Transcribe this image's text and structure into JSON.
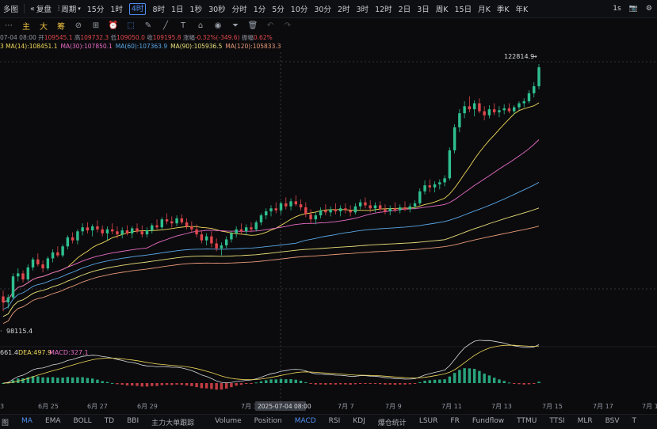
{
  "toolbar": {
    "multi_chart_label": "多图",
    "replay_label": "复盘",
    "period_label": "周期",
    "intervals": [
      "15分",
      "1时",
      "4时",
      "8时",
      "1日",
      "1秒",
      "30秒",
      "分时",
      "1分",
      "5分",
      "10分",
      "30分",
      "2时",
      "3时",
      "12时",
      "2日",
      "3日",
      "周K",
      "15日",
      "月K",
      "季K",
      "年K"
    ],
    "active_interval": "4时",
    "realtime_label": "1s"
  },
  "drawbar": {
    "indicator_labels": [
      "主",
      "大",
      "筹"
    ]
  },
  "ohlc": {
    "date": "07-04 08:00",
    "open_label": "开",
    "open": "109545.1",
    "high_label": "高",
    "high": "109732.3",
    "low_label": "低",
    "low": "109050.0",
    "close_label": "收",
    "close": "109195.8",
    "change_label": "涨幅",
    "change": "-0.32%(-349.6)",
    "amp_label": "振幅",
    "amp": "0.62%"
  },
  "ma": [
    {
      "text": "MA(14):108451.1",
      "color": "#f0d85a"
    },
    {
      "text": "MA(30):107850.1",
      "color": "#e86cc7"
    },
    {
      "text": "MA(60):107363.9",
      "color": "#5aa7e6"
    },
    {
      "text": "MA(90):105936.5",
      "color": "#e9e07a"
    },
    {
      "text": "MA(120):105833.3",
      "color": "#e89a7a"
    }
  ],
  "ma_prefix": "3",
  "price_labels": {
    "high_marker": "122814.9",
    "low_marker": "98115.4"
  },
  "macd_info": {
    "dif": "661.4",
    "dea": "DEA:497.9",
    "macd": "MACD:327.1"
  },
  "x_labels": [
    "3",
    "6月 25",
    "6月 27",
    "6月 29",
    "7月 3",
    "7月 7",
    "7月 9",
    "7月 11",
    "7月 13",
    "7月 15",
    "7月 17",
    "7月 1"
  ],
  "crosshair_date": "2025-07-04 08:00",
  "bottom_tabs": [
    "MA",
    "EMA",
    "BOLL",
    "TD",
    "BBI",
    "主力大单跟踪",
    "Volume",
    "Position",
    "MACD",
    "RSI",
    "KDJ",
    "爆仓统计",
    "LSUR",
    "FR",
    "Fundflow",
    "TTMU",
    "TTSI",
    "MLR",
    "BSV",
    "T"
  ],
  "bottom_left_label": "图",
  "active_main_tab": "MA",
  "active_sub_tab": "MACD",
  "colors": {
    "up": "#2fbf8f",
    "down": "#e0474c",
    "accent": "#4f8df0"
  },
  "chart_data": {
    "type": "candlestick",
    "interval": "4时",
    "candles": [
      [
        99600,
        100200,
        98115,
        99000
      ],
      [
        99000,
        99800,
        98400,
        99500
      ],
      [
        99500,
        101900,
        99300,
        101600
      ],
      [
        101600,
        102400,
        101100,
        101900
      ],
      [
        101900,
        102200,
        101000,
        101300
      ],
      [
        101300,
        102800,
        101100,
        102500
      ],
      [
        102500,
        103500,
        102200,
        103300
      ],
      [
        103300,
        103900,
        102600,
        102800
      ],
      [
        102800,
        103200,
        102000,
        102400
      ],
      [
        102400,
        103600,
        102200,
        103400
      ],
      [
        103400,
        104300,
        103000,
        104000
      ],
      [
        104000,
        104600,
        103500,
        103700
      ],
      [
        103700,
        104800,
        103500,
        104600
      ],
      [
        104600,
        105700,
        104300,
        105500
      ],
      [
        105500,
        106000,
        104900,
        105200
      ],
      [
        105200,
        106300,
        104800,
        106100
      ],
      [
        106100,
        106900,
        105700,
        106500
      ],
      [
        106500,
        107000,
        105900,
        106200
      ],
      [
        106200,
        106800,
        105600,
        106600
      ],
      [
        106600,
        107200,
        106000,
        106300
      ],
      [
        106300,
        106700,
        105600,
        105900
      ],
      [
        105900,
        106600,
        105200,
        106300
      ],
      [
        106300,
        106900,
        105800,
        106100
      ],
      [
        106100,
        106600,
        105400,
        105800
      ],
      [
        105800,
        106500,
        105400,
        106200
      ],
      [
        106200,
        106700,
        105700,
        105900
      ],
      [
        105900,
        106600,
        105400,
        106400
      ],
      [
        106400,
        106900,
        105900,
        106100
      ],
      [
        106100,
        106700,
        105500,
        105800
      ],
      [
        105800,
        106500,
        105500,
        106200
      ],
      [
        106200,
        106900,
        105900,
        106700
      ],
      [
        106700,
        107300,
        106300,
        106500
      ],
      [
        106500,
        107500,
        106200,
        107300
      ],
      [
        107300,
        107900,
        106800,
        107100
      ],
      [
        107100,
        107600,
        106500,
        106900
      ],
      [
        106900,
        107700,
        106600,
        107400
      ],
      [
        107400,
        107800,
        106800,
        107000
      ],
      [
        107000,
        107400,
        106300,
        106600
      ],
      [
        106600,
        107100,
        106000,
        106300
      ],
      [
        106300,
        106800,
        105500,
        105800
      ],
      [
        105800,
        106200,
        104900,
        105200
      ],
      [
        105200,
        105900,
        104700,
        105600
      ],
      [
        105600,
        106100,
        104500,
        104900
      ],
      [
        104900,
        105400,
        104100,
        104400
      ],
      [
        104400,
        105000,
        103700,
        104700
      ],
      [
        104700,
        105600,
        104400,
        105300
      ],
      [
        105300,
        106100,
        105000,
        105900
      ],
      [
        105900,
        106600,
        105500,
        106300
      ],
      [
        106300,
        106900,
        105800,
        106100
      ],
      [
        106100,
        106800,
        105700,
        106500
      ],
      [
        106500,
        107000,
        106000,
        106300
      ],
      [
        106300,
        107200,
        106100,
        107000
      ],
      [
        107000,
        107900,
        106700,
        107700
      ],
      [
        107700,
        108400,
        107300,
        108100
      ],
      [
        108100,
        108700,
        107600,
        108400
      ],
      [
        108400,
        109000,
        107900,
        108200
      ],
      [
        108200,
        109100,
        107800,
        108900
      ],
      [
        108900,
        109500,
        108300,
        108600
      ],
      [
        108600,
        109400,
        108200,
        109100
      ],
      [
        109100,
        109700,
        108600,
        108800
      ],
      [
        108800,
        109300,
        108200,
        108500
      ],
      [
        108500,
        109000,
        107500,
        107800
      ],
      [
        107800,
        108300,
        106900,
        107300
      ],
      [
        107300,
        108000,
        106800,
        107700
      ],
      [
        107700,
        108500,
        107400,
        108200
      ],
      [
        108200,
        108800,
        107700,
        108000
      ],
      [
        108000,
        108600,
        107600,
        108300
      ],
      [
        108300,
        108900,
        107800,
        108100
      ],
      [
        108100,
        108700,
        107600,
        108400
      ],
      [
        108400,
        108900,
        107900,
        108200
      ],
      [
        108200,
        108700,
        107600,
        108000
      ],
      [
        108000,
        108900,
        107800,
        108600
      ],
      [
        108600,
        109300,
        108300,
        109000
      ],
      [
        109000,
        109500,
        108400,
        108700
      ],
      [
        108700,
        109200,
        108000,
        108400
      ],
      [
        108400,
        109000,
        108000,
        108700
      ],
      [
        108700,
        109100,
        108100,
        108300
      ],
      [
        108300,
        108800,
        107800,
        108100
      ],
      [
        108100,
        108700,
        107700,
        108400
      ],
      [
        108400,
        109000,
        108000,
        108200
      ],
      [
        108200,
        108800,
        107900,
        108500
      ],
      [
        108500,
        109100,
        108100,
        108300
      ],
      [
        108300,
        108900,
        108000,
        108600
      ],
      [
        108600,
        109200,
        108300,
        108900
      ],
      [
        108900,
        110400,
        108700,
        110100
      ],
      [
        110100,
        111200,
        109800,
        110700
      ],
      [
        110700,
        111300,
        110000,
        110500
      ],
      [
        110500,
        111100,
        110000,
        110800
      ],
      [
        110800,
        111300,
        110300,
        111000
      ],
      [
        111000,
        111700,
        110600,
        111400
      ],
      [
        111400,
        114500,
        111200,
        114200
      ],
      [
        114200,
        116800,
        113900,
        116500
      ],
      [
        116500,
        118300,
        116000,
        117900
      ],
      [
        117900,
        119100,
        117400,
        118600
      ],
      [
        118600,
        119600,
        118000,
        118300
      ],
      [
        118300,
        119200,
        117600,
        118900
      ],
      [
        118900,
        119400,
        117900,
        118100
      ],
      [
        118100,
        118600,
        117200,
        117700
      ],
      [
        117700,
        118700,
        117400,
        118300
      ],
      [
        118300,
        118900,
        117700,
        118000
      ],
      [
        118000,
        118600,
        117500,
        118200
      ],
      [
        118200,
        118800,
        117800,
        118400
      ],
      [
        118400,
        118900,
        117900,
        118100
      ],
      [
        118100,
        118700,
        117800,
        118500
      ],
      [
        118500,
        119100,
        118200,
        118900
      ],
      [
        118900,
        119400,
        118500,
        119100
      ],
      [
        119100,
        120200,
        118900,
        119900
      ],
      [
        119900,
        121000,
        119500,
        120600
      ],
      [
        120600,
        122814.9,
        120300,
        122500
      ]
    ],
    "ma_series": [
      "MA14",
      "MA30",
      "MA60",
      "MA90",
      "MA120"
    ],
    "price_range": [
      96000,
      124000
    ],
    "macd_range": [
      -900,
      1600
    ]
  }
}
